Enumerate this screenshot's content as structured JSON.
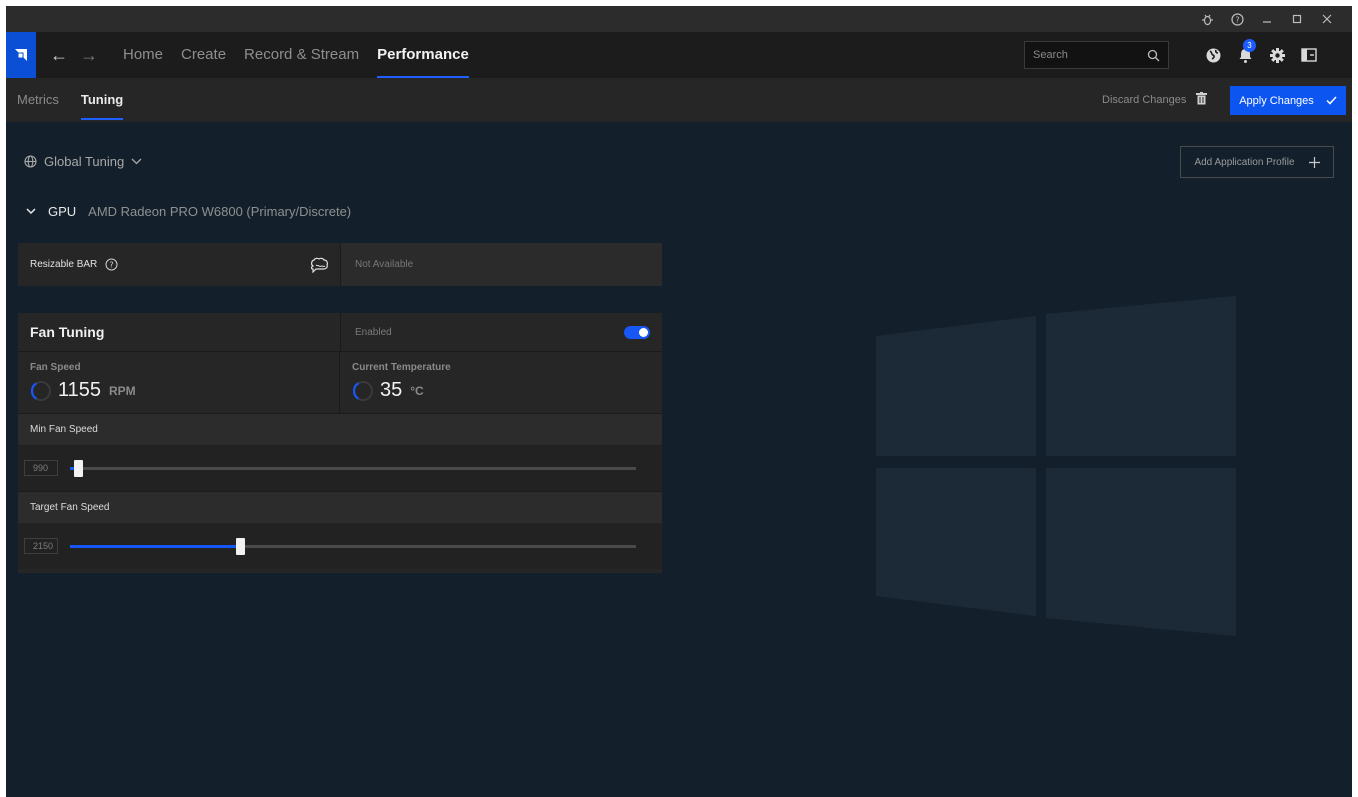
{
  "titlebar": {
    "icons": [
      "bug-icon",
      "help-icon",
      "minimize-icon",
      "maximize-icon",
      "close-icon"
    ]
  },
  "nav": {
    "tabs": [
      "Home",
      "Create",
      "Record & Stream",
      "Performance"
    ],
    "active_tab": "Performance",
    "search_placeholder": "Search",
    "notification_count": "3"
  },
  "subnav": {
    "tabs": [
      "Metrics",
      "Tuning"
    ],
    "active_tab": "Tuning",
    "discard_label": "Discard Changes",
    "apply_label": "Apply Changes"
  },
  "tuning": {
    "profile_label": "Global Tuning",
    "add_profile_label": "Add Application Profile",
    "gpu_label": "GPU",
    "gpu_name": "AMD Radeon PRO W6800 (Primary/Discrete)"
  },
  "resizable_bar": {
    "label": "Resizable BAR",
    "status": "Not Available"
  },
  "fan_tuning": {
    "title": "Fan Tuning",
    "status_label": "Enabled",
    "enabled": true,
    "fan_speed_label": "Fan Speed",
    "fan_speed_value": "1155",
    "fan_speed_unit": "RPM",
    "temp_label": "Current Temperature",
    "temp_value": "35",
    "temp_unit": "°C",
    "min_fan_label": "Min Fan Speed",
    "min_fan_value": "990",
    "min_fan_fraction": 0.0,
    "target_fan_label": "Target Fan Speed",
    "target_fan_value": "2150",
    "target_fan_fraction": 0.3
  },
  "colors": {
    "accent": "#1657f5",
    "background": "#13202c",
    "panel": "#262626"
  }
}
